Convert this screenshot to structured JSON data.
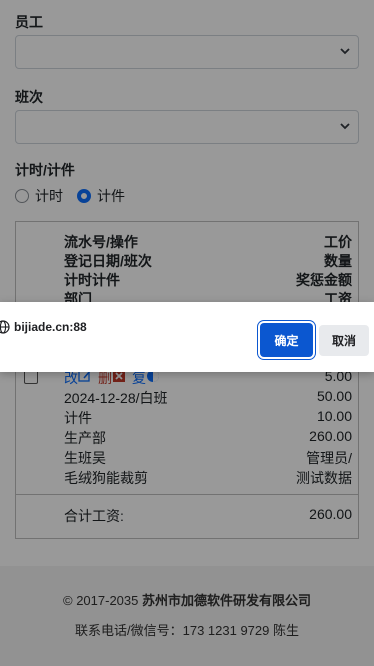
{
  "form": {
    "employee_label": "员工",
    "shift_label": "班次",
    "mode_label": "计时/计件",
    "mode_options": [
      "计时",
      "计件"
    ],
    "mode_selected": "计件"
  },
  "table": {
    "headers": [
      {
        "left": "流水号/操作",
        "right": "工价"
      },
      {
        "left": "登记日期/班次",
        "right": "数量"
      },
      {
        "left": "计时计件",
        "right": "奖惩金额"
      },
      {
        "left": "部门",
        "right": "工资"
      }
    ],
    "record": {
      "actions": [
        "改",
        "删",
        "复"
      ],
      "price": "5.00",
      "date_shift": "2024-12-28/白班",
      "quantity": "50.00",
      "type": "计件",
      "bonus": "10.00",
      "department": "生产部",
      "wage": "260.00",
      "team": "生班吴",
      "operator": "管理员/",
      "product": "毛绒狗能裁剪",
      "note": "测试数据"
    },
    "total_label": "合计工资:",
    "total_value": "260.00"
  },
  "footer": {
    "copyright_prefix": "© 2017-2035",
    "company": "苏州市加德软件研发有限公司",
    "contact": "联系电话/微信号：173 1231 9729 陈生"
  },
  "dialog": {
    "origin": "bijiade.cn:88",
    "confirm_label": "确定",
    "cancel_label": "取消"
  },
  "colors": {
    "primary": "#0d6efd",
    "dialog_button": "#0b57d0"
  }
}
